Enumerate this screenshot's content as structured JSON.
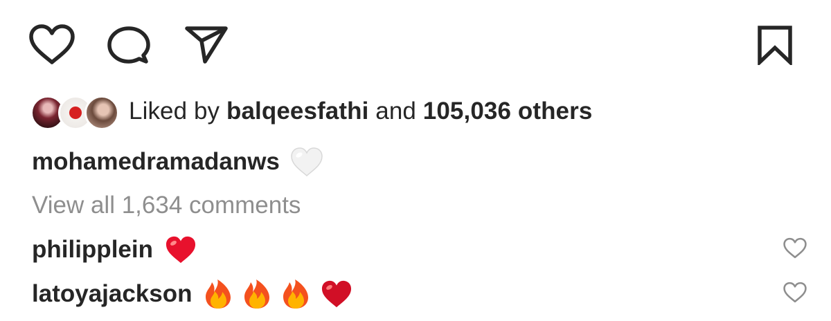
{
  "actions": {
    "like": "heart-outline-icon",
    "comment": "comment-bubble-icon",
    "share": "paper-plane-icon",
    "save": "bookmark-icon"
  },
  "likes": {
    "prefix": "Liked by",
    "user": "balqeesfathi",
    "connector": "and",
    "count_text": "105,036 others"
  },
  "caption": {
    "username": "mohamedramadanws",
    "emoji": "white-heart"
  },
  "view_all": "View all 1,634 comments",
  "comments": [
    {
      "username": "philipplein",
      "emojis": [
        "red-heart"
      ]
    },
    {
      "username": "latoyajackson",
      "emojis": [
        "fire",
        "fire",
        "fire",
        "red-heart"
      ]
    }
  ],
  "colors": {
    "text": "#262626",
    "muted": "#8e8e8e",
    "red_heart": "#e8112d",
    "white_heart": "#f2f2f2"
  }
}
